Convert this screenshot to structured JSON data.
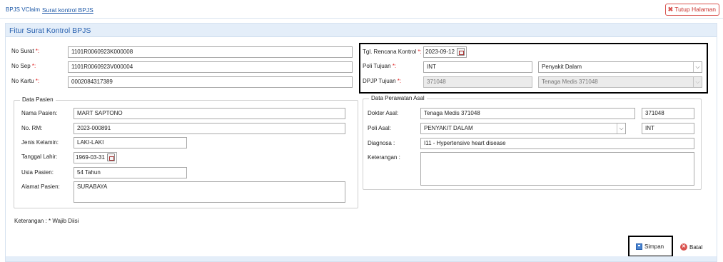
{
  "tabs": {
    "app": "BPJS VClaim",
    "active": "Surat kontrol BPJS"
  },
  "close_button": "Tutup Halaman",
  "panel_title": "Fitur Surat Kontrol BPJS",
  "form": {
    "no_surat": {
      "label": "No Surat ",
      "value": "1101R0060923K000008"
    },
    "no_sep": {
      "label": "No Sep ",
      "value": "1101R0060923V000004"
    },
    "no_kartu": {
      "label": "No Kartu ",
      "value": "0002084317389"
    },
    "required_mark": "*:",
    "tgl_rencana": {
      "label": "Tgl. Rencana Kontrol ",
      "value": "2023-09-12"
    },
    "poli_tujuan": {
      "label": "Poli Tujuan ",
      "code": "INT",
      "name": "Penyakit Dalam"
    },
    "dpjp_tujuan": {
      "label": "DPJP Tujuan ",
      "code": "371048",
      "name": "Tenaga Medis 371048"
    }
  },
  "data_pasien": {
    "legend": "Data Pasien",
    "nama": {
      "label": "Nama Pasien:",
      "value": "MART SAPTONO"
    },
    "no_rm": {
      "label": "No. RM:",
      "value": "2023-000891"
    },
    "jenis_kelamin": {
      "label": "Jenis Kelamin:",
      "value": "LAKI-LAKI"
    },
    "tanggal_lahir": {
      "label": "Tanggal Lahir:",
      "value": "1969-03-31"
    },
    "usia": {
      "label": "Usia Pasien:",
      "value": "54 Tahun"
    },
    "alamat": {
      "label": "Alamat Pasien:",
      "value": "SURABAYA"
    }
  },
  "data_perawatan": {
    "legend": "Data Perawatan Asal",
    "dokter": {
      "label": "Dokter Asal:",
      "name": "Tenaga Medis 371048",
      "code": "371048"
    },
    "poli": {
      "label": "Poli Asal:",
      "name": "PENYAKIT DALAM",
      "code": "INT"
    },
    "diagnosa": {
      "label": "Diagnosa :",
      "value": "I11 - Hypertensive heart disease"
    },
    "keterangan": {
      "label": "Keterangan :",
      "value": ""
    }
  },
  "footnote": "Keterangan : * Wajib Diisi",
  "buttons": {
    "save": "Simpan",
    "cancel": "Batal"
  },
  "colors": {
    "accent": "#2a62b0",
    "header_bg": "#e4eef9",
    "required": "#e02020",
    "danger": "#d9534f"
  }
}
